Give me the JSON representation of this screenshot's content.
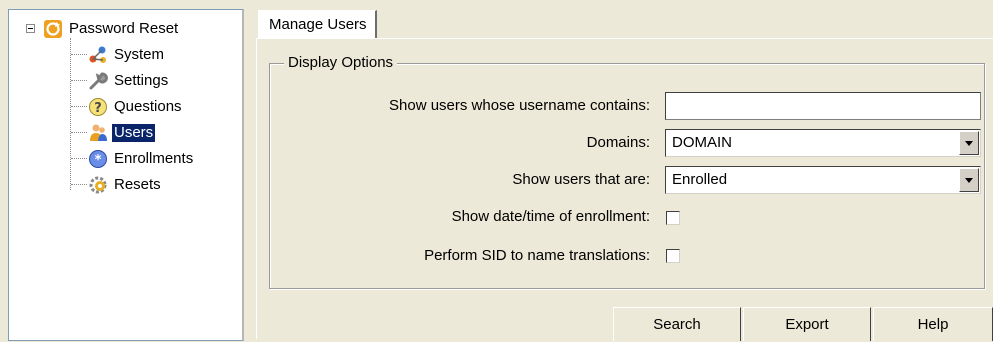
{
  "tree": {
    "root": {
      "label": "Password Reset",
      "icon": "password-reset-icon"
    },
    "items": [
      {
        "label": "System",
        "icon": "system-icon"
      },
      {
        "label": "Settings",
        "icon": "wrench-icon"
      },
      {
        "label": "Questions",
        "icon": "question-icon"
      },
      {
        "label": "Users",
        "icon": "users-icon",
        "selected": true
      },
      {
        "label": "Enrollments",
        "icon": "enrollments-icon"
      },
      {
        "label": "Resets",
        "icon": "resets-icon"
      }
    ]
  },
  "tabs": [
    {
      "label": "Manage Users",
      "active": true
    }
  ],
  "display_options": {
    "title": "Display Options",
    "username_filter": {
      "label": "Show users whose username contains:",
      "value": ""
    },
    "domains": {
      "label": "Domains:",
      "value": "DOMAIN"
    },
    "user_state": {
      "label": "Show users that are:",
      "value": "Enrolled"
    },
    "show_enrollment_time": {
      "label": "Show date/time of enrollment:",
      "checked": false
    },
    "sid_translation": {
      "label": "Perform SID to name translations:",
      "checked": false
    }
  },
  "buttons": {
    "search": "Search",
    "export": "Export",
    "help": "Help"
  },
  "colors": {
    "selection": "#0a246a",
    "window_bg": "#ece9d8"
  }
}
